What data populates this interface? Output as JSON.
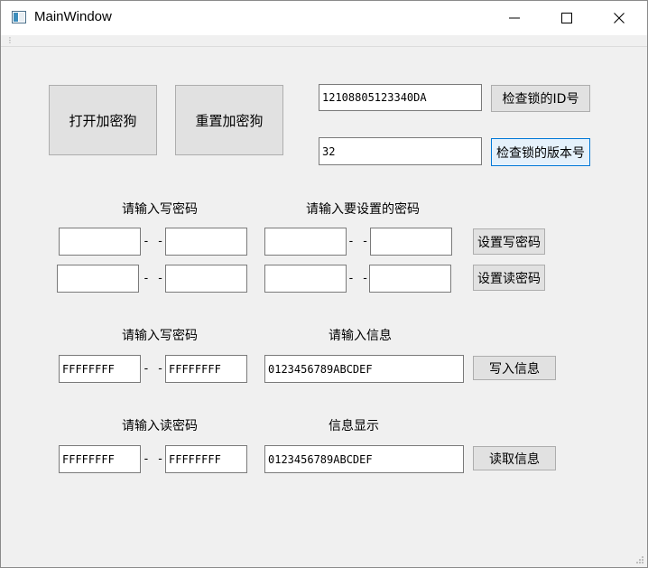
{
  "window": {
    "title": "MainWindow",
    "controls": {
      "minimize_icon": "minimize-icon",
      "maximize_icon": "maximize-icon",
      "close_icon": "close-icon"
    }
  },
  "dongle": {
    "open_label": "打开加密狗",
    "reset_label": "重置加密狗",
    "id_value": "12108805123340DA",
    "check_id_label": "检查锁的ID号",
    "version_value": "32",
    "check_version_label": "检查锁的版本号"
  },
  "password_setup": {
    "write_prompt": "请输入写密码",
    "new_prompt": "请输入要设置的密码",
    "separator": "- -",
    "row1": {
      "old_a": "",
      "old_b": "",
      "new_a": "",
      "new_b": "",
      "button": "设置写密码"
    },
    "row2": {
      "old_a": "",
      "old_b": "",
      "new_a": "",
      "new_b": "",
      "button": "设置读密码"
    }
  },
  "write_section": {
    "password_prompt": "请输入写密码",
    "info_prompt": "请输入信息",
    "pw_a": "FFFFFFFF",
    "pw_b": "FFFFFFFF",
    "info_value": "0123456789ABCDEF",
    "button": "写入信息"
  },
  "read_section": {
    "password_prompt": "请输入读密码",
    "info_prompt": "信息显示",
    "pw_a": "FFFFFFFF",
    "pw_b": "FFFFFFFF",
    "info_value": "0123456789ABCDEF",
    "button": "读取信息"
  },
  "colors": {
    "focus_border": "#0078d7",
    "button_bg": "#e1e1e1",
    "window_bg": "#f0f0f0"
  }
}
